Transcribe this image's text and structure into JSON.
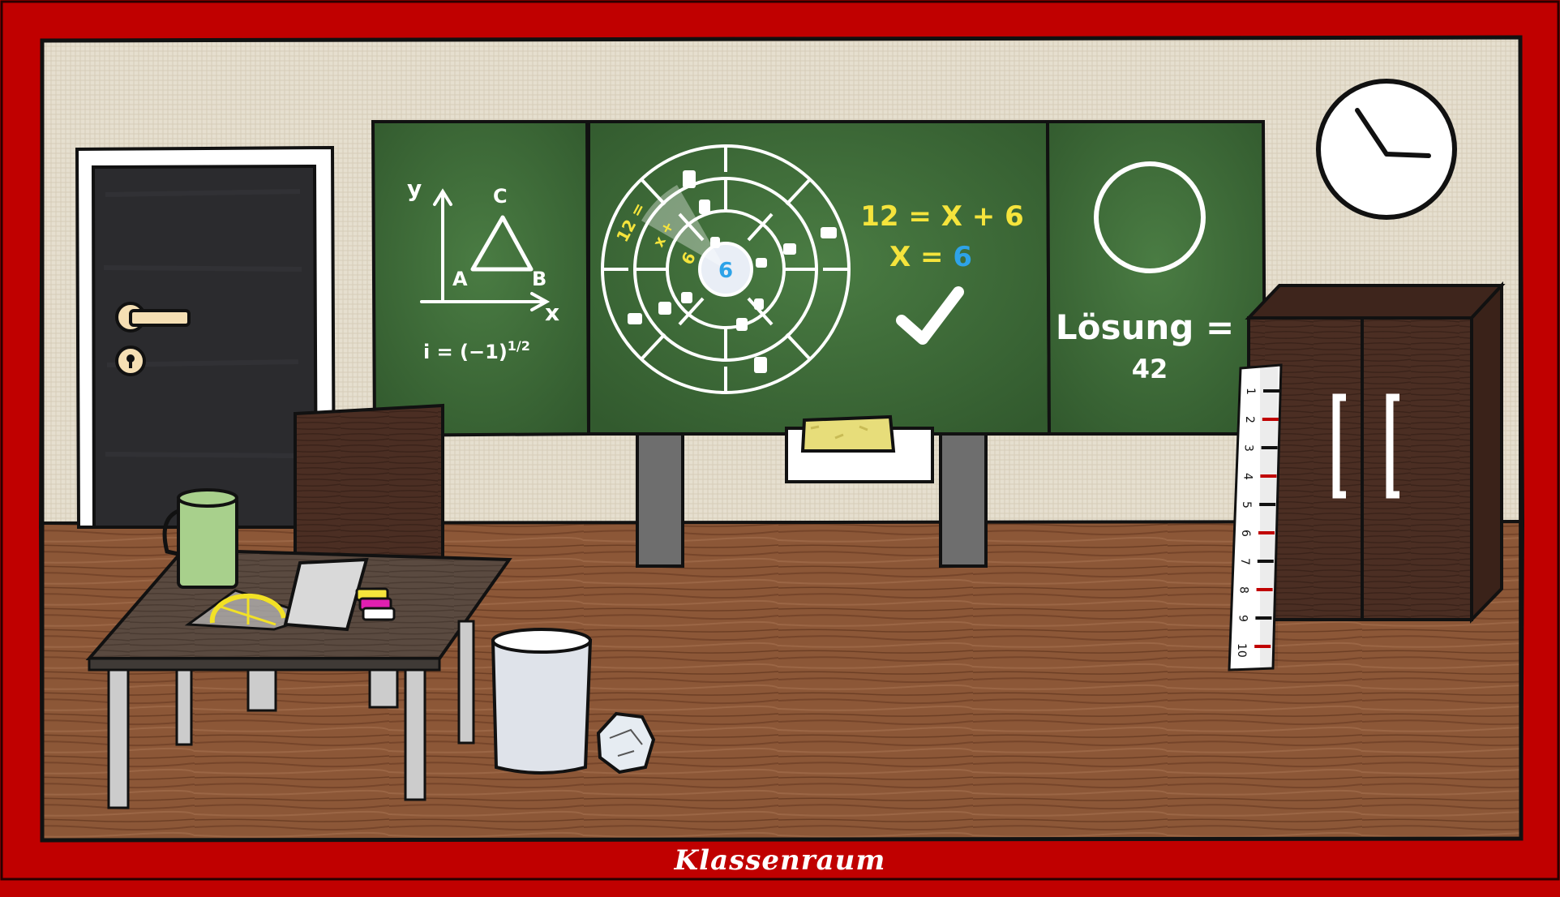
{
  "room_title": "Klassenraum",
  "colors": {
    "frame": "#c00000",
    "wall": "#e4dccb",
    "floor": "#8a5536",
    "board": "#3f6e3a",
    "chalk_white": "#ffffff",
    "chalk_yellow": "#f5e43c",
    "chalk_blue": "#2ea3e8",
    "wood_dark": "#4a2e22"
  },
  "left_board": {
    "axis_y": "y",
    "axis_x": "x",
    "vertex_a": "A",
    "vertex_b": "B",
    "vertex_c": "C",
    "formula": "i = (−1)",
    "formula_exp": "1/2"
  },
  "middle_board": {
    "wheel_center": "6",
    "wheel_ring_values": [
      "12 =",
      "x +",
      "6"
    ],
    "equation_line1": "12 = X + 6",
    "equation_line2_prefix": "X = ",
    "equation_line2_value": "6"
  },
  "right_board": {
    "solution_label": "Lösung =",
    "solution_value": "42"
  },
  "ruler_numbers": [
    "1",
    "2",
    "3",
    "4",
    "5",
    "6",
    "7",
    "8",
    "9",
    "10"
  ]
}
